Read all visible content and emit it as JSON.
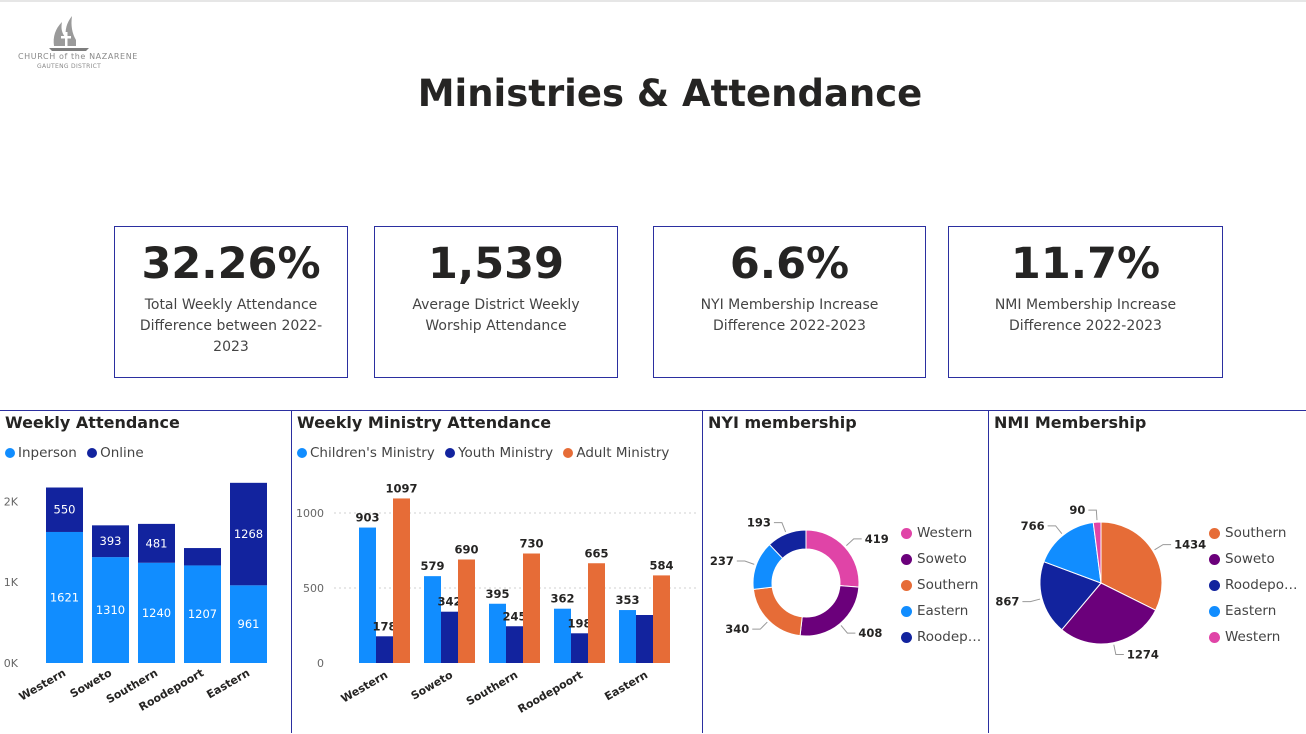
{
  "logo": {
    "line1": "CHURCH of the NAZARENE",
    "line2": "GAUTENG DISTRICT"
  },
  "title": "Ministries & Attendance",
  "kpis": [
    {
      "value": "32.26%",
      "label": "Total Weekly Attendance Difference between 2022-2023"
    },
    {
      "value": "1,539",
      "label": "Average District Weekly Worship Attendance"
    },
    {
      "value": "6.6%",
      "label": "NYI Membership Increase Difference 2022-2023"
    },
    {
      "value": "11.7%",
      "label": "NMI Membership Increase Difference 2022-2023"
    }
  ],
  "panels": {
    "weekly": {
      "title": "Weekly Attendance",
      "legend": [
        "Inperson",
        "Online"
      ]
    },
    "ministry": {
      "title": "Weekly Ministry Attendance",
      "legend": [
        "Children's Ministry",
        "Youth Ministry",
        "Adult Ministry"
      ]
    },
    "nyi": {
      "title": "NYI membership"
    },
    "nmi": {
      "title": "NMI Membership"
    }
  },
  "colors": {
    "light_blue": "#118dff",
    "dark_blue": "#12239e",
    "orange": "#e66c37",
    "pink": "#e044a7",
    "purple": "#6b007b",
    "border": "#2b2fa0"
  },
  "chart_data": [
    {
      "type": "bar",
      "stacked": true,
      "title": "Weekly Attendance",
      "categories": [
        "Western",
        "Soweto",
        "Southern",
        "Roodepoort",
        "Eastern"
      ],
      "series": [
        {
          "name": "Inperson",
          "values": [
            1621,
            1310,
            1240,
            1207,
            961
          ],
          "color": "#118dff",
          "labels": [
            "1621",
            "1310",
            "1240",
            "1207",
            "961"
          ]
        },
        {
          "name": "Online",
          "values": [
            550,
            393,
            481,
            215,
            1268
          ],
          "color": "#12239e",
          "labels": [
            "550",
            "393",
            "481",
            "",
            "1268"
          ]
        }
      ],
      "yticks": [
        {
          "value": 0,
          "label": "0K"
        },
        {
          "value": 1000,
          "label": "1K"
        },
        {
          "value": 2000,
          "label": "2K"
        }
      ],
      "ylim": [
        0,
        2400
      ],
      "legend_position": "top-left"
    },
    {
      "type": "bar",
      "title": "Weekly Ministry Attendance",
      "categories": [
        "Western",
        "Soweto",
        "Southern",
        "Roodepoort",
        "Eastern"
      ],
      "series": [
        {
          "name": "Children's Ministry",
          "values": [
            903,
            579,
            395,
            362,
            353
          ],
          "color": "#118dff",
          "labels": [
            "903",
            "579",
            "395",
            "362",
            "353"
          ]
        },
        {
          "name": "Youth Ministry",
          "values": [
            178,
            342,
            245,
            198,
            320
          ],
          "color": "#12239e",
          "labels": [
            "178",
            "342",
            "245",
            "198",
            ""
          ]
        },
        {
          "name": "Adult Ministry",
          "values": [
            1097,
            690,
            730,
            665,
            584
          ],
          "color": "#e66c37",
          "labels": [
            "1097",
            "690",
            "730",
            "665",
            "584"
          ]
        }
      ],
      "yticks": [
        {
          "value": 0,
          "label": "0"
        },
        {
          "value": 500,
          "label": "500"
        },
        {
          "value": 1000,
          "label": "1000"
        }
      ],
      "ylim": [
        0,
        1200
      ],
      "gridlines": true,
      "legend_position": "top-left"
    },
    {
      "type": "pie",
      "donut": true,
      "title": "NYI membership",
      "slices": [
        {
          "label": "Western",
          "value": 419,
          "color": "#e044a7"
        },
        {
          "label": "Soweto",
          "value": 408,
          "color": "#6b007b"
        },
        {
          "label": "Southern",
          "value": 340,
          "color": "#e66c37"
        },
        {
          "label": "Eastern",
          "value": 237,
          "color": "#118dff"
        },
        {
          "label": "Roodep…",
          "value": 193,
          "color": "#12239e"
        }
      ],
      "legend_position": "right"
    },
    {
      "type": "pie",
      "title": "NMI Membership",
      "slices": [
        {
          "label": "Southern",
          "value": 1434,
          "color": "#e66c37"
        },
        {
          "label": "Soweto",
          "value": 1274,
          "color": "#6b007b"
        },
        {
          "label": "Roodepo…",
          "value": 867,
          "color": "#12239e"
        },
        {
          "label": "Eastern",
          "value": 766,
          "color": "#118dff"
        },
        {
          "label": "Western",
          "value": 90,
          "color": "#e044a7"
        }
      ],
      "legend_position": "right"
    }
  ]
}
